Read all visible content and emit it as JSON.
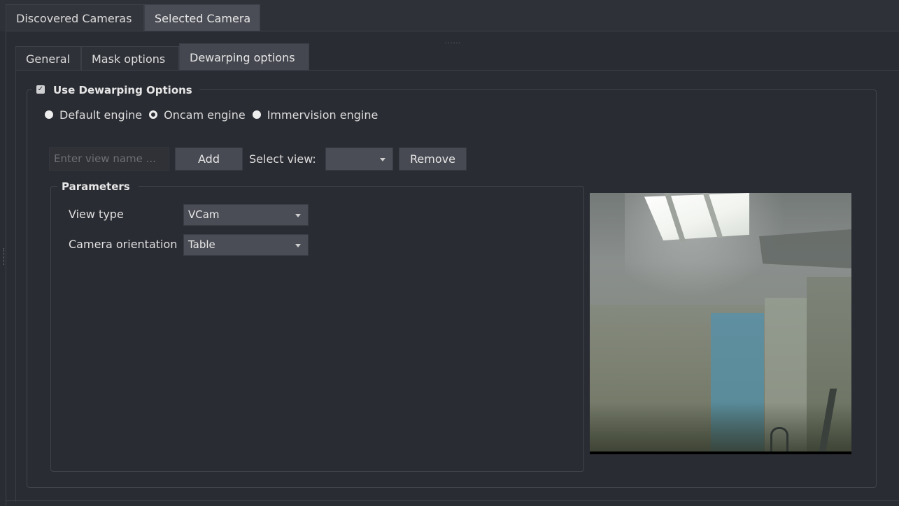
{
  "outer_tabs": [
    {
      "label": "Discovered Cameras",
      "active": false
    },
    {
      "label": "Selected Camera",
      "active": true
    }
  ],
  "splitter_handle": "......",
  "inner_tabs": [
    {
      "label": "General",
      "active": false
    },
    {
      "label": "Mask options",
      "active": false
    },
    {
      "label": "Dewarping options",
      "active": true
    }
  ],
  "dewarping": {
    "use_label": "Use Dewarping Options",
    "use_checked": true,
    "engines": [
      {
        "label": "Default engine",
        "checked": false
      },
      {
        "label": "Oncam engine",
        "checked": true
      },
      {
        "label": "Immervision engine",
        "checked": false
      }
    ],
    "view_name_placeholder": "Enter view name ...",
    "view_name_value": "",
    "add_label": "Add",
    "select_view_label": "Select view:",
    "select_view_value": "",
    "remove_label": "Remove"
  },
  "parameters": {
    "title": "Parameters",
    "view_type_label": "View type",
    "view_type_value": "VCam",
    "orientation_label": "Camera orientation",
    "orientation_value": "Table"
  },
  "icons": {
    "combo_arrow": "chevron-down-icon",
    "checkbox": "checkbox-checked-icon"
  }
}
